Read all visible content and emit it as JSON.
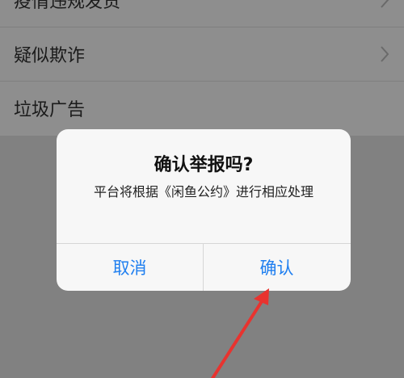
{
  "list": {
    "items": [
      {
        "label": "疫情违规发货"
      },
      {
        "label": "疑似欺诈"
      },
      {
        "label": "垃圾广告"
      }
    ]
  },
  "dialog": {
    "title": "确认举报吗?",
    "message": "平台将根据《闲鱼公约》进行相应处理",
    "cancel_label": "取消",
    "confirm_label": "确认",
    "button_color": "#1f7ff0"
  },
  "annotation": {
    "arrow_color": "#e8332f"
  }
}
